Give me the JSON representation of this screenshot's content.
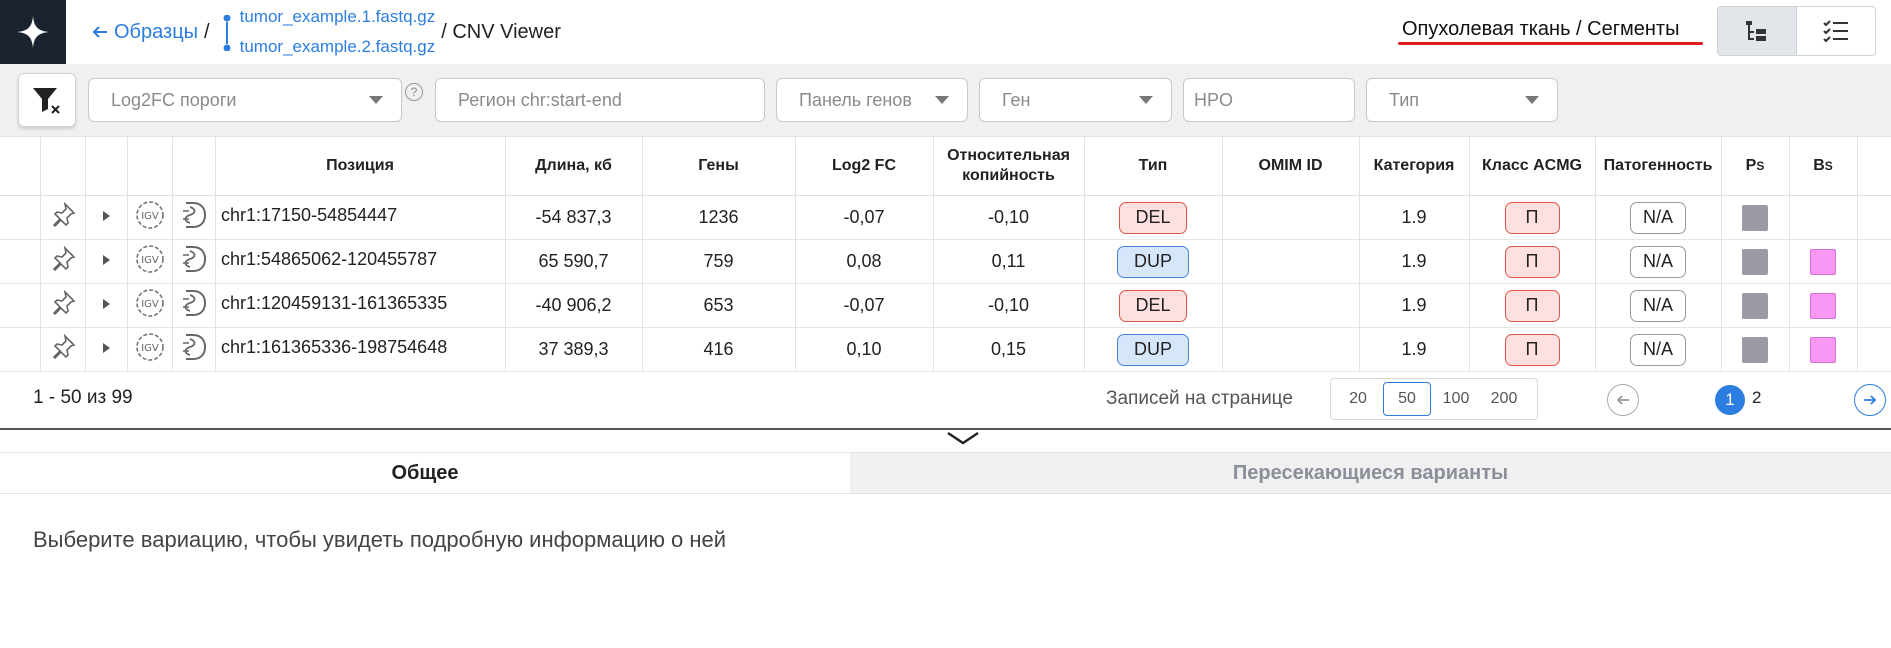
{
  "header": {
    "back_label": "Образцы",
    "separator": "/",
    "files": [
      "tumor_example.1.fastq.gz",
      "tumor_example.2.fastq.gz"
    ],
    "viewer": "/ CNV Viewer",
    "context": "Опухолевая ткань / Сегменты",
    "view_icons": [
      "tree-view-icon",
      "checklist-view-icon"
    ]
  },
  "filters": {
    "log2fc_placeholder": "Log2FC пороги",
    "region_placeholder": "Регион chr:start-end",
    "panel_placeholder": "Панель генов",
    "gene_placeholder": "Ген",
    "hpo_placeholder": "HPO",
    "type_placeholder": "Тип",
    "help": "?"
  },
  "table": {
    "headers": {
      "position": "Позиция",
      "length": "Длина, кб",
      "genes": "Гены",
      "log2fc": "Log2 FC",
      "relcopy_1": "Относительная",
      "relcopy_2": "копийность",
      "type": "Тип",
      "omim": "OMIM ID",
      "category": "Категория",
      "acmg": "Класс ACMG",
      "pathogenicity": "Патогенность",
      "ps": "P",
      "ps_sub": "S",
      "bs": "B",
      "bs_sub": "S"
    },
    "rows": [
      {
        "position": "chr1:17150-54854447",
        "length": "-54 837,3",
        "genes": "1236",
        "log2fc": "-0,07",
        "relcopy": "-0,10",
        "type": "DEL",
        "omim": "",
        "category": "1.9",
        "acmg": "П",
        "pathogenicity": "N/A",
        "ps": true,
        "bs": false
      },
      {
        "position": "chr1:54865062-120455787",
        "length": "65 590,7",
        "genes": "759",
        "log2fc": "0,08",
        "relcopy": "0,11",
        "type": "DUP",
        "omim": "",
        "category": "1.9",
        "acmg": "П",
        "pathogenicity": "N/A",
        "ps": true,
        "bs": true
      },
      {
        "position": "chr1:120459131-161365335",
        "length": "-40 906,2",
        "genes": "653",
        "log2fc": "-0,07",
        "relcopy": "-0,10",
        "type": "DEL",
        "omim": "",
        "category": "1.9",
        "acmg": "П",
        "pathogenicity": "N/A",
        "ps": true,
        "bs": true
      },
      {
        "position": "chr1:161365336-198754648",
        "length": "37 389,3",
        "genes": "416",
        "log2fc": "0,10",
        "relcopy": "0,15",
        "type": "DUP",
        "omim": "",
        "category": "1.9",
        "acmg": "П",
        "pathogenicity": "N/A",
        "ps": true,
        "bs": true
      }
    ],
    "row_icons": [
      "pin-icon",
      "expand-caret-icon",
      "igv-icon",
      "decipher-icon"
    ]
  },
  "pagination": {
    "range": "1 - 50 из 99",
    "per_page_label": "Записей на странице",
    "per_page_options": [
      "20",
      "50",
      "100",
      "200"
    ],
    "per_page_selected": "50",
    "pages": [
      "1",
      "2"
    ],
    "current_page": "1"
  },
  "details": {
    "tab_general": "Общее",
    "tab_overlapping": "Пересекающиеся варианты",
    "empty_message": "Выберите вариацию, чтобы увидеть подробную информацию о ней"
  },
  "colors": {
    "accent": "#2b7de0",
    "del_bg": "#fde0df",
    "dup_bg": "#d7e7fb",
    "ps": "#9b9aa5",
    "bs": "#f897f4",
    "logo_bg": "#1b2230",
    "underline": "#e01b1b"
  }
}
